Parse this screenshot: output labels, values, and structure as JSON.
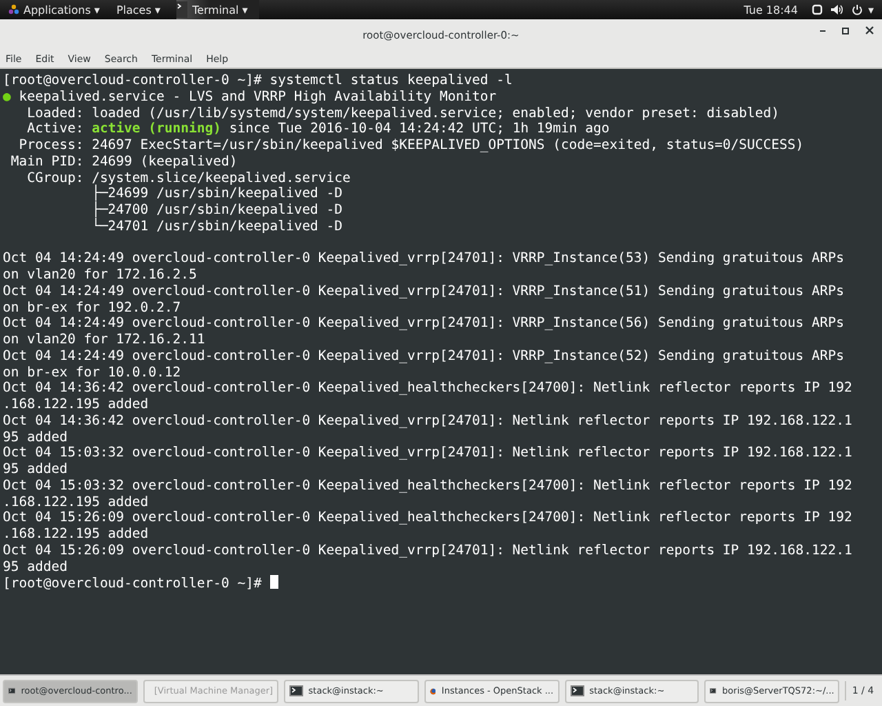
{
  "top_bar": {
    "menus": [
      {
        "label": "Applications",
        "caret": "▾"
      },
      {
        "label": "Places",
        "caret": "▾"
      }
    ],
    "active_app": {
      "label": "Terminal",
      "caret": "▾"
    },
    "clock": "Tue 18:44",
    "system_caret": "▾"
  },
  "window": {
    "title": "root@overcloud-controller-0:~",
    "menu": [
      "File",
      "Edit",
      "View",
      "Search",
      "Terminal",
      "Help"
    ]
  },
  "terminal": {
    "lines": [
      {
        "kind": "text",
        "text": "[root@overcloud-controller-0 ~]# systemctl status keepalived -l"
      },
      {
        "kind": "unit",
        "bullet": "●",
        "text": " keepalived.service - LVS and VRRP High Availability Monitor"
      },
      {
        "kind": "text",
        "text": "   Loaded: loaded (/usr/lib/systemd/system/keepalived.service; enabled; vendor preset: disabled)"
      },
      {
        "kind": "active",
        "prefix": "   Active: ",
        "state": "active (running)",
        "text": " since Tue 2016-10-04 14:24:42 UTC; 1h 19min ago"
      },
      {
        "kind": "text",
        "text": "  Process: 24697 ExecStart=/usr/sbin/keepalived $KEEPALIVED_OPTIONS (code=exited, status=0/SUCCESS)"
      },
      {
        "kind": "text",
        "text": " Main PID: 24699 (keepalived)"
      },
      {
        "kind": "text",
        "text": "   CGroup: /system.slice/keepalived.service"
      },
      {
        "kind": "text",
        "text": "           ├─24699 /usr/sbin/keepalived -D"
      },
      {
        "kind": "text",
        "text": "           ├─24700 /usr/sbin/keepalived -D"
      },
      {
        "kind": "text",
        "text": "           └─24701 /usr/sbin/keepalived -D"
      },
      {
        "kind": "blank"
      },
      {
        "kind": "text",
        "text": "Oct 04 14:24:49 overcloud-controller-0 Keepalived_vrrp[24701]: VRRP_Instance(53) Sending gratuitous ARPs"
      },
      {
        "kind": "text",
        "text": "on vlan20 for 172.16.2.5"
      },
      {
        "kind": "text",
        "text": "Oct 04 14:24:49 overcloud-controller-0 Keepalived_vrrp[24701]: VRRP_Instance(51) Sending gratuitous ARPs"
      },
      {
        "kind": "text",
        "text": "on br-ex for 192.0.2.7"
      },
      {
        "kind": "text",
        "text": "Oct 04 14:24:49 overcloud-controller-0 Keepalived_vrrp[24701]: VRRP_Instance(56) Sending gratuitous ARPs"
      },
      {
        "kind": "text",
        "text": "on vlan20 for 172.16.2.11"
      },
      {
        "kind": "text",
        "text": "Oct 04 14:24:49 overcloud-controller-0 Keepalived_vrrp[24701]: VRRP_Instance(52) Sending gratuitous ARPs"
      },
      {
        "kind": "text",
        "text": "on br-ex for 10.0.0.12"
      },
      {
        "kind": "text",
        "text": "Oct 04 14:36:42 overcloud-controller-0 Keepalived_healthcheckers[24700]: Netlink reflector reports IP 192"
      },
      {
        "kind": "text",
        "text": ".168.122.195 added"
      },
      {
        "kind": "text",
        "text": "Oct 04 14:36:42 overcloud-controller-0 Keepalived_vrrp[24701]: Netlink reflector reports IP 192.168.122.1"
      },
      {
        "kind": "text",
        "text": "95 added"
      },
      {
        "kind": "text",
        "text": "Oct 04 15:03:32 overcloud-controller-0 Keepalived_vrrp[24701]: Netlink reflector reports IP 192.168.122.1"
      },
      {
        "kind": "text",
        "text": "95 added"
      },
      {
        "kind": "text",
        "text": "Oct 04 15:03:32 overcloud-controller-0 Keepalived_healthcheckers[24700]: Netlink reflector reports IP 192"
      },
      {
        "kind": "text",
        "text": ".168.122.195 added"
      },
      {
        "kind": "text",
        "text": "Oct 04 15:26:09 overcloud-controller-0 Keepalived_healthcheckers[24700]: Netlink reflector reports IP 192"
      },
      {
        "kind": "text",
        "text": ".168.122.195 added"
      },
      {
        "kind": "text",
        "text": "Oct 04 15:26:09 overcloud-controller-0 Keepalived_vrrp[24701]: Netlink reflector reports IP 192.168.122.1"
      },
      {
        "kind": "text",
        "text": "95 added"
      },
      {
        "kind": "prompt",
        "text": "[root@overcloud-controller-0 ~]# "
      }
    ]
  },
  "taskbar": {
    "items": [
      {
        "kind": "terminal",
        "label": "root@overcloud-contro...",
        "selected": true,
        "minimized": false
      },
      {
        "kind": "vm",
        "label": "[Virtual Machine Manager]",
        "selected": false,
        "minimized": true
      },
      {
        "kind": "terminal",
        "label": "stack@instack:~",
        "selected": false,
        "minimized": false
      },
      {
        "kind": "browser",
        "label": "Instances - OpenStack ...",
        "selected": false,
        "minimized": false
      },
      {
        "kind": "terminal",
        "label": "stack@instack:~",
        "selected": false,
        "minimized": false
      },
      {
        "kind": "terminal",
        "label": "boris@ServerTQS72:~/...",
        "selected": false,
        "minimized": false
      }
    ],
    "workspace": "1 / 4"
  }
}
